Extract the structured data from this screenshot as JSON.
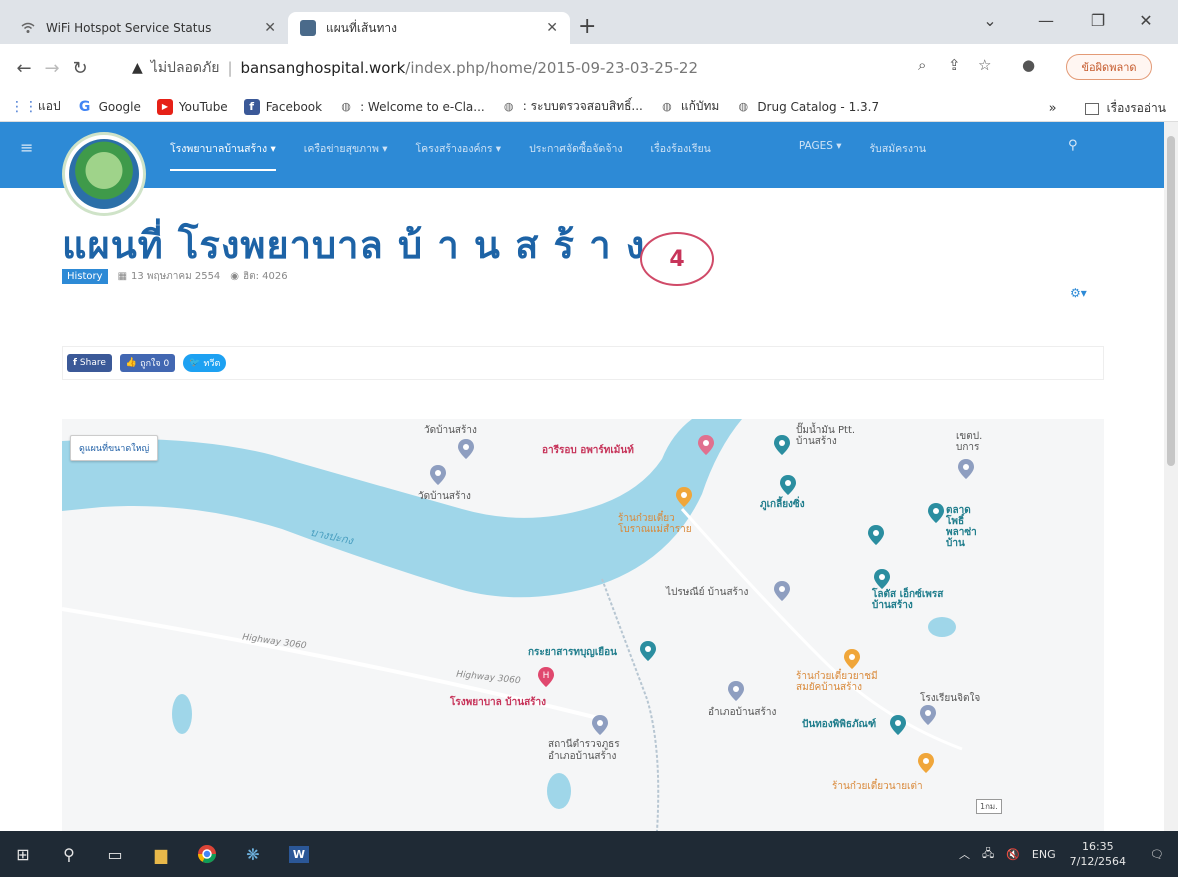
{
  "browser": {
    "tabs": [
      {
        "title": "WiFi Hotspot Service Status",
        "icon": "wifi-icon"
      },
      {
        "title": "แผนที่เส้นทาง",
        "icon": "map-favicon"
      }
    ],
    "new_tab": "+",
    "window_controls": {
      "chevron": "⌄",
      "minimize": "—",
      "restore": "❐",
      "close": "✕"
    },
    "not_secure_label": "ไม่ปลอดภัย",
    "url_host": "bansanghospital.work",
    "url_path": "/index.php/home/2015-09-23-03-25-22",
    "error_pill": "ข้อผิดพลาด",
    "bookmarks": [
      {
        "label": "แอป",
        "icon": "apps-grid-icon"
      },
      {
        "label": "Google",
        "icon": "google-icon"
      },
      {
        "label": "YouTube",
        "icon": "youtube-icon"
      },
      {
        "label": "Facebook",
        "icon": "facebook-icon"
      },
      {
        "label": ": Welcome to e-Cla...",
        "icon": "globe-icon"
      },
      {
        "label": ": ระบบตรวจสอบสิทธิ์...",
        "icon": "globe-icon"
      },
      {
        "label": "แก้บัทม",
        "icon": "globe-icon"
      },
      {
        "label": "Drug Catalog - 1.3.7",
        "icon": "globe-icon"
      }
    ],
    "bookmarks_more": "»",
    "reading_list": "เรื่องรออ่าน"
  },
  "site": {
    "menu": [
      {
        "label": "โรงพยาบาลบ้านสร้าง ▾",
        "active": true
      },
      {
        "label": "เครือข่ายสุขภาพ ▾",
        "active": false
      },
      {
        "label": "โครงสร้างองค์กร ▾",
        "active": false
      },
      {
        "label": "ประกาศจัดซื้อจัดจ้าง",
        "active": false
      },
      {
        "label": "เรื่องร้องเรียน",
        "active": false
      },
      {
        "label": "PAGES ▾",
        "active": false
      },
      {
        "label": "รับสมัครงาน",
        "active": false
      }
    ],
    "search_icon": "search-icon"
  },
  "article": {
    "title": "แผนที่ โรงพยาบาล บ้ า น ส ร้ า ง",
    "category": "History",
    "date": "13 พฤษภาคม 2554",
    "hits": "ฮิต: 4026",
    "annotation_number": "4",
    "share": {
      "facebook": "Share",
      "like": "ถูกใจ 0",
      "tweet": "ทวีต"
    }
  },
  "map": {
    "button": "ดูแผนที่ขนาดใหญ่",
    "labels": {
      "wat1": "วัดบ้านสร้าง",
      "wat2": "วัดบ้านสร้าง",
      "river": "บางปะกง",
      "restaurant": "อารีรอบ อพาร์ทเม้นท์",
      "ptt": "ปั๊มน้ำมัน Ptt. บ้านสร้าง",
      "school": "เขตป. บการ",
      "noodle1": "ร้านก๋วยเตี๋ยว โบราณแม่สำราย",
      "shop1": "ภูเกลี้ยงซิ่ง",
      "market": "ตลาดโพธิ์ พลาซ่า บ้าน",
      "post": "ไปรษณีย์ บ้านสร้าง",
      "lotus": "โลตัส เอ็กซ์เพรส บ้านสร้าง",
      "highway1": "Highway 3060",
      "highway2": "Highway 3060",
      "ricefield": "กระยาสารทบุญเยือน",
      "noodle2": "ร้านก๋วยเตี๋ยวยาชมีสมยัคบ้านสร้าง",
      "hospital": "โรงพยาบาล บ้านสร้าง",
      "district": "อำเภอบ้านสร้าง",
      "bank": "ปันทองพิพิธภัณฑ์",
      "school2": "โรงเรียนจิตใจ",
      "police": "สถานีตำรวจภูธร อำเภอบ้านสร้าง",
      "noodle3": "ร้านก๋วยเตี๋ยวนายเต่า",
      "scale": "1กม."
    }
  },
  "taskbar": {
    "lang": "ENG",
    "time": "16:35",
    "date": "7/12/2564"
  },
  "colors": {
    "site_blue": "#2d8ad6",
    "title_blue": "#1d63a6",
    "river": "#9fd6e9",
    "annotation": "#c7345a"
  }
}
